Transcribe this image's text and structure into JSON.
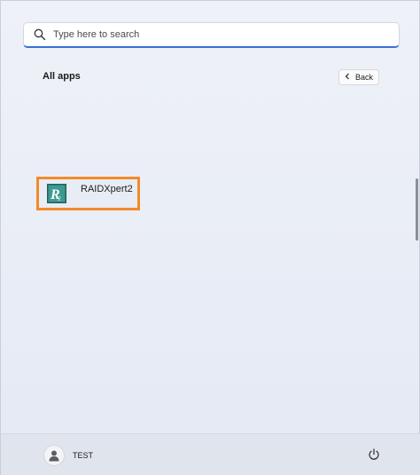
{
  "search": {
    "placeholder": "Type here to search",
    "value": ""
  },
  "all_apps": {
    "title": "All apps",
    "back_label": "Back"
  },
  "apps": [
    {
      "label": "RAIDXpert2",
      "icon": "raidxpert2-app-icon",
      "highlight_color": "#f28a2b"
    }
  ],
  "footer": {
    "user_name": "TEST",
    "user_icon": "user-avatar-icon",
    "power_icon": "power-icon"
  },
  "colors": {
    "accent": "#3b6fd6",
    "highlight": "#f28a2b",
    "app_icon_bg": "#2f7f7a"
  }
}
